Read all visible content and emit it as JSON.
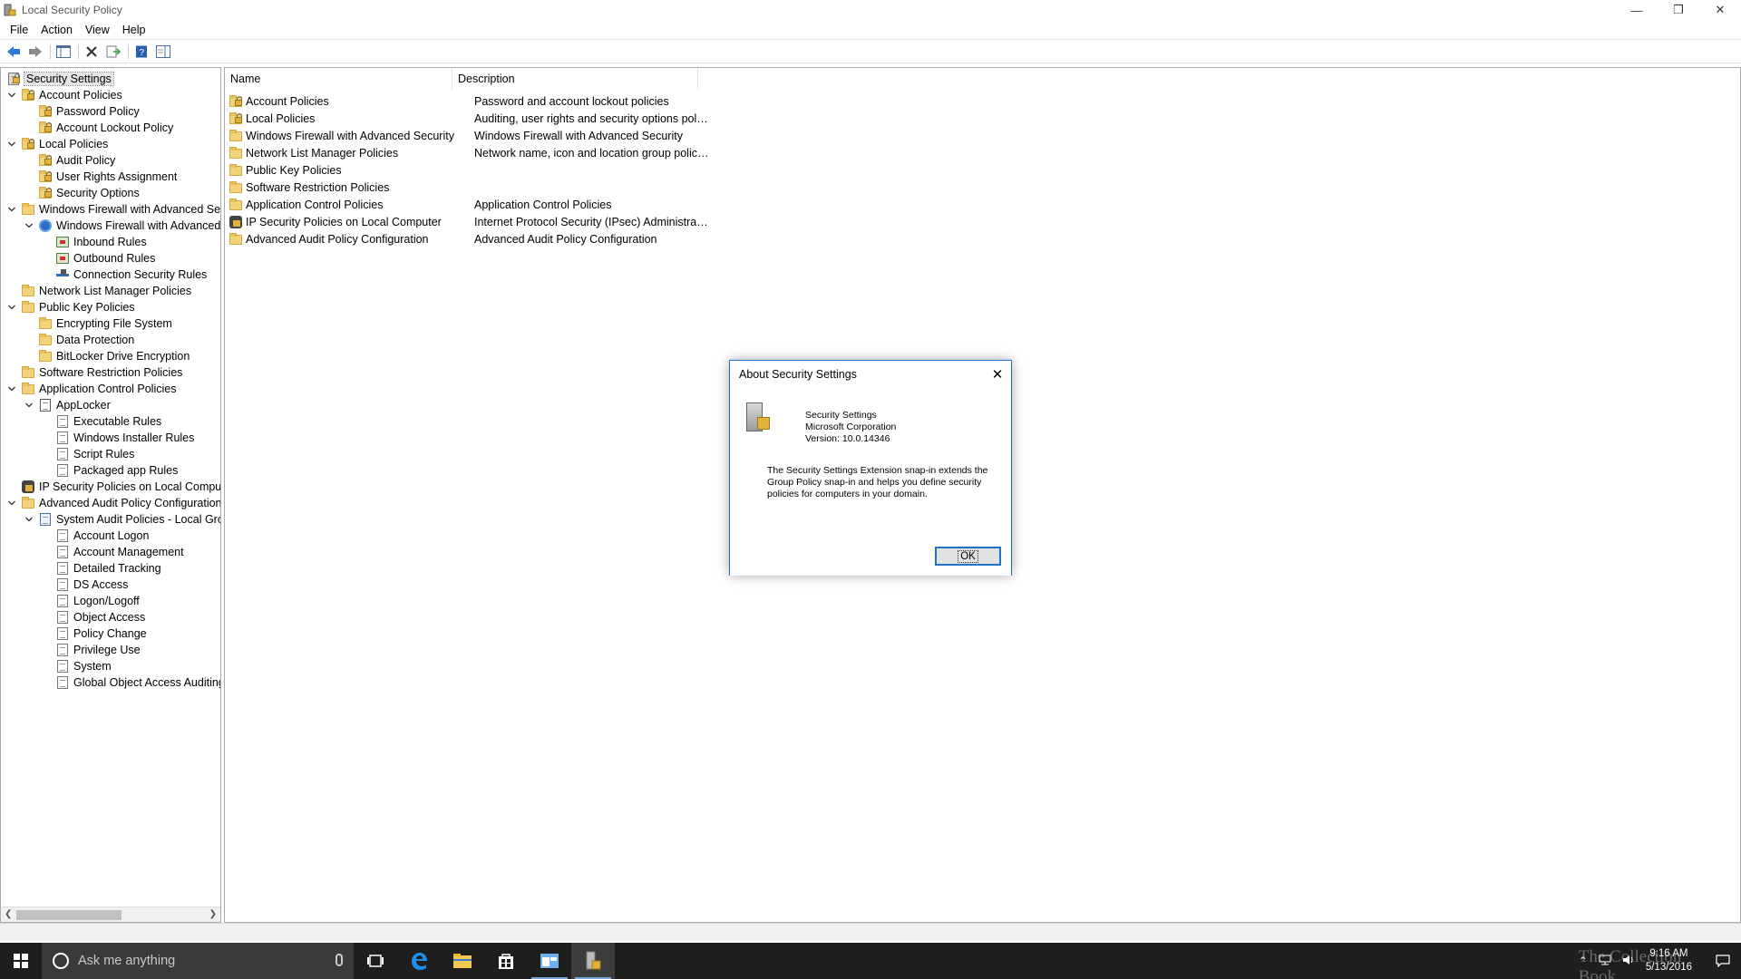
{
  "window": {
    "title": "Local Security Policy",
    "minimize": "—",
    "restore": "❐",
    "close": "✕"
  },
  "menu": [
    "File",
    "Action",
    "View",
    "Help"
  ],
  "tree": {
    "items": [
      {
        "label": "Security Settings",
        "level": 0,
        "icon": "security-settings-icon",
        "expand": ""
      },
      {
        "label": "Account Policies",
        "level": 1,
        "icon": "folder-lock-icon",
        "expand": "v"
      },
      {
        "label": "Password Policy",
        "level": 2,
        "icon": "folder-lock-icon",
        "expand": ""
      },
      {
        "label": "Account Lockout Policy",
        "level": 2,
        "icon": "folder-lock-icon",
        "expand": ""
      },
      {
        "label": "Local Policies",
        "level": 1,
        "icon": "folder-lock-icon",
        "expand": "v"
      },
      {
        "label": "Audit Policy",
        "level": 2,
        "icon": "folder-lock-icon",
        "expand": ""
      },
      {
        "label": "User Rights Assignment",
        "level": 2,
        "icon": "folder-lock-icon",
        "expand": ""
      },
      {
        "label": "Security Options",
        "level": 2,
        "icon": "folder-lock-icon",
        "expand": ""
      },
      {
        "label": "Windows Firewall with Advanced Secu",
        "level": 1,
        "icon": "folder-icon",
        "expand": "v"
      },
      {
        "label": "Windows Firewall with Advanced",
        "level": 2,
        "icon": "firewall-icon",
        "expand": "v"
      },
      {
        "label": "Inbound Rules",
        "level": 3,
        "icon": "inbound-rules-icon",
        "expand": ""
      },
      {
        "label": "Outbound Rules",
        "level": 3,
        "icon": "outbound-rules-icon",
        "expand": ""
      },
      {
        "label": "Connection Security Rules",
        "level": 3,
        "icon": "connection-rules-icon",
        "expand": ""
      },
      {
        "label": "Network List Manager Policies",
        "level": 1,
        "icon": "folder-icon",
        "expand": ""
      },
      {
        "label": "Public Key Policies",
        "level": 1,
        "icon": "folder-icon",
        "expand": "v"
      },
      {
        "label": "Encrypting File System",
        "level": 2,
        "icon": "folder-icon",
        "expand": ""
      },
      {
        "label": "Data Protection",
        "level": 2,
        "icon": "folder-icon",
        "expand": ""
      },
      {
        "label": "BitLocker Drive Encryption",
        "level": 2,
        "icon": "folder-icon",
        "expand": ""
      },
      {
        "label": "Software Restriction Policies",
        "level": 1,
        "icon": "folder-icon",
        "expand": ""
      },
      {
        "label": "Application Control Policies",
        "level": 1,
        "icon": "folder-icon",
        "expand": "v"
      },
      {
        "label": "AppLocker",
        "level": 2,
        "icon": "applocker-icon",
        "expand": "v"
      },
      {
        "label": "Executable Rules",
        "level": 3,
        "icon": "document-icon",
        "expand": ""
      },
      {
        "label": "Windows Installer Rules",
        "level": 3,
        "icon": "document-icon",
        "expand": ""
      },
      {
        "label": "Script Rules",
        "level": 3,
        "icon": "document-icon",
        "expand": ""
      },
      {
        "label": "Packaged app Rules",
        "level": 3,
        "icon": "document-icon",
        "expand": ""
      },
      {
        "label": "IP Security Policies on Local Compute",
        "level": 1,
        "icon": "ipsec-icon",
        "expand": ""
      },
      {
        "label": "Advanced Audit Policy Configuration",
        "level": 1,
        "icon": "folder-icon",
        "expand": "v"
      },
      {
        "label": "System Audit Policies - Local Grou",
        "level": 2,
        "icon": "audit-policies-icon",
        "expand": "v"
      },
      {
        "label": "Account Logon",
        "level": 3,
        "icon": "document-icon",
        "expand": ""
      },
      {
        "label": "Account Management",
        "level": 3,
        "icon": "document-icon",
        "expand": ""
      },
      {
        "label": "Detailed Tracking",
        "level": 3,
        "icon": "document-icon",
        "expand": ""
      },
      {
        "label": "DS Access",
        "level": 3,
        "icon": "document-icon",
        "expand": ""
      },
      {
        "label": "Logon/Logoff",
        "level": 3,
        "icon": "document-icon",
        "expand": ""
      },
      {
        "label": "Object Access",
        "level": 3,
        "icon": "document-icon",
        "expand": ""
      },
      {
        "label": "Policy Change",
        "level": 3,
        "icon": "document-icon",
        "expand": ""
      },
      {
        "label": "Privilege Use",
        "level": 3,
        "icon": "document-icon",
        "expand": ""
      },
      {
        "label": "System",
        "level": 3,
        "icon": "document-icon",
        "expand": ""
      },
      {
        "label": "Global Object Access Auditing",
        "level": 3,
        "icon": "document-icon",
        "expand": ""
      }
    ]
  },
  "list": {
    "columns": [
      "Name",
      "Description"
    ],
    "rows": [
      {
        "name": "Account Policies",
        "desc": "Password and account lockout policies",
        "icon": "folder-lock-icon"
      },
      {
        "name": "Local Policies",
        "desc": "Auditing, user rights and security options polici...",
        "icon": "folder-lock-icon"
      },
      {
        "name": "Windows Firewall with Advanced Security",
        "desc": "Windows Firewall with Advanced Security",
        "icon": "folder-icon"
      },
      {
        "name": "Network List Manager Policies",
        "desc": "Network name, icon and location group policies.",
        "icon": "folder-icon"
      },
      {
        "name": "Public Key Policies",
        "desc": "",
        "icon": "folder-icon"
      },
      {
        "name": "Software Restriction Policies",
        "desc": "",
        "icon": "folder-icon"
      },
      {
        "name": "Application Control Policies",
        "desc": "Application Control Policies",
        "icon": "folder-icon"
      },
      {
        "name": "IP Security Policies on Local Computer",
        "desc": "Internet Protocol Security (IPsec) Administratio...",
        "icon": "ipsec-icon"
      },
      {
        "name": "Advanced Audit Policy Configuration",
        "desc": "Advanced Audit Policy Configuration",
        "icon": "folder-icon"
      }
    ]
  },
  "dialog": {
    "title": "About Security Settings",
    "product": "Security Settings",
    "company": "Microsoft Corporation",
    "version": "Version: 10.0.14346",
    "description": "The Security Settings Extension snap-in extends the Group Policy snap-in and helps you define security policies for computers in your domain.",
    "ok": "OK"
  },
  "taskbar": {
    "search_placeholder": "Ask me anything",
    "time": "9:16 AM",
    "date": "5/13/2016",
    "watermark": "The Collection Book"
  },
  "colors": {
    "accent": "#1f72c5",
    "taskbar": "#1e1e1e"
  }
}
